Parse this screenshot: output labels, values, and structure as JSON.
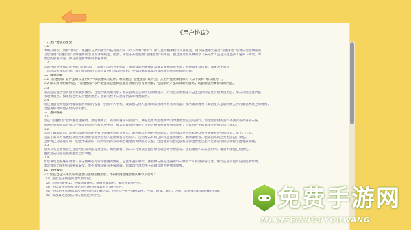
{
  "header": {
    "back_icon": "back-arrow-icon",
    "back_color": "#f5a35c"
  },
  "document": {
    "title": "《用户协议》",
    "lines": [
      {
        "kind": "heading",
        "text": "一、用户协议的接受"
      },
      {
        "kind": "num",
        "text": "1.1"
      },
      {
        "kind": "body-text",
        "text": "本用户协议（简称“协议”）系由您与杭州嘟云科技有限公司（以下简称“嘟云”）所订立的相关权利义务规范，用以描述嘟云通过“悲维加加”软件向您提供服务"
      },
      {
        "kind": "body-text",
        "text": "及您使用“悲维加加”软件服务所涉及的详细规定。因此，请您于开始使用“悲维加加”软件前，独立思考及认真阅读（未成年人应在法定监护人陪同下阅读）本"
      },
      {
        "kind": "body-text",
        "text": "协议的所有内容。并充分理解本协议中各条款。"
      },
      {
        "kind": "num",
        "text": "1.2"
      },
      {
        "kind": "body-text",
        "text": "您的开始使用嘟云提供的“悲维加加”，即表示您已充分同意了本协议的相关规定及嘟云发布或者更新，并愿意受其约束。如果发生纠纷"
      },
      {
        "kind": "body-text",
        "text": "，您应自行承担后果。我们保留随时对本协议进行修改的权利，不得以未阅读本协议内容作任何形式的抗辩。"
      },
      {
        "kind": "heading",
        "text": "二、服务内容"
      },
      {
        "kind": "num",
        "text": "2.1 “悲维加加”软件是嘟云提供的一款思维练习软件，嘟云通过“悲维加加”软件为广大用户提供课程练习（以下简称“嘟云服务”）。"
      },
      {
        "kind": "num",
        "text": "2.2 除非另有明确约定，“悲维加加”软件增强或强化目前服务功能的所有新功能，包括新的产品以及新的服务，均自动适用本协议的约定。"
      },
      {
        "kind": "num",
        "text": "2.3"
      },
      {
        "kind": "body-text",
        "text": "嘟云应您提供免费服务和收费服务。在提供收费服务前，嘟云会向您告知待付明确提示，只有在您根据提示自主选择同意支付相关费用后，嘟云才向您提供该"
      },
      {
        "kind": "body-text",
        "text": "等收费服务。如果您拒绝支付相关费用，嘟云有权不向您提供该等收费服务。"
      },
      {
        "kind": "num",
        "text": "2.4"
      },
      {
        "kind": "body-text",
        "text": "您应当自行负担使用嘟云服务所需的设备（例如个人手机、及其他与接入互联网或移动网有关的装置）及所需的费用（如为接入互联网而支付的电话费及上网费用，"
      },
      {
        "kind": "body-text",
        "text": "为使用移动网而支付的手机费）。"
      },
      {
        "kind": "heading",
        "text": "三、用户账号"
      },
      {
        "kind": "num",
        "text": "3.1"
      },
      {
        "kind": "body-text",
        "text": "您在“悲维加加”软件进行注册时，须提供真实、有效的身份识别资料，并在信息状态更新时及时更新您提交的资料。如因您提供的资料不真实或不符或未按"
      },
      {
        "kind": "body-text",
        "text": "提供的资料与以往资料不真实的与他人权利冲突时，嘟云有权暂停或终止您的注册资格或身份的使用，因此而产生的法律责任由您自行承担。"
      },
      {
        "kind": "num",
        "text": "3.2"
      },
      {
        "kind": "body-text",
        "text": "您须了解和认可，悲维加加账号的使用权仅归属于原始注册人，未经嘟云的事先书面同意，您不得以任何形式将自身注册账号及密码转让、赠予、出借、"
      },
      {
        "kind": "body-text",
        "text": "售卖予第三方或通过其他方式将账号提供给他人使用或者借给他人。否则嘟云有权立即停止提供服务、删除该账号，由此造成的后果由您自行承担。"
      },
      {
        "kind": "body-text",
        "text": "立即停止对该账号的一切使用及操作，同时嘟云有权采取合理措施保障账号安全，经由嘟云公告后该账号即由原始注册人之请求或依法律程序由嘟云处理。"
      },
      {
        "kind": "num",
        "text": "3.3"
      },
      {
        "kind": "body-text",
        "text": "您有义务妥善保管在注册时获得的账号及密码，如因黑客、第三人行为或您自身保管疏忽等导致账号、密码遭他人非法使用的，嘟云不承担任何责任。"
      },
      {
        "kind": "body-text",
        "text": "由此造成的您的损失由您自行承担。"
      },
      {
        "kind": "num",
        "text": "3.4"
      },
      {
        "kind": "body-text",
        "text": "如您发现自身账号遭他人非法使用或有异常使用的情形，应立即通知嘟云，并提供与账号注册资料一致的个人有效身份信息，嘟云在核实后可向您提供帮助。"
      },
      {
        "kind": "body-text",
        "text": "嘟云会尽力保护您的账号安全，但不能保证账号不被盗取，您需自行承担由于非嘟云原因导致的损失。"
      },
      {
        "kind": "heading",
        "text": "四、使用规则"
      },
      {
        "kind": "num",
        "text": "4.1 您应当在法律允许的范围内使用悲维加加，不得利用悲维加加从事以下行为："
      },
      {
        "kind": "body-text",
        "text": "（1）违反宪法确定的基本原则的；"
      },
      {
        "kind": "body-text",
        "text": "（2）危害国家安全、泄露国家秘密、颠覆国家政权、破坏国家统一的；"
      },
      {
        "kind": "body-text",
        "text": "（3）不得以任何形式侵犯他人著作权或其他合法权益的；"
      },
      {
        "kind": "body-text",
        "text": "（4）不得利用悲维加加从事任何违法犯罪活动，包括但不限于散布淫秽、色情、赌博、暴力、凶杀、恐怖或者教唆犯罪的内容；"
      },
      {
        "kind": "body-text",
        "text": "（5）以及其他违反法律法规规定的行为。"
      }
    ]
  },
  "watermark": {
    "title": "免费手游网",
    "subtitle": "MIANFEISHOUYOUWANG",
    "logo_icon": "gamepad-logo-icon"
  }
}
